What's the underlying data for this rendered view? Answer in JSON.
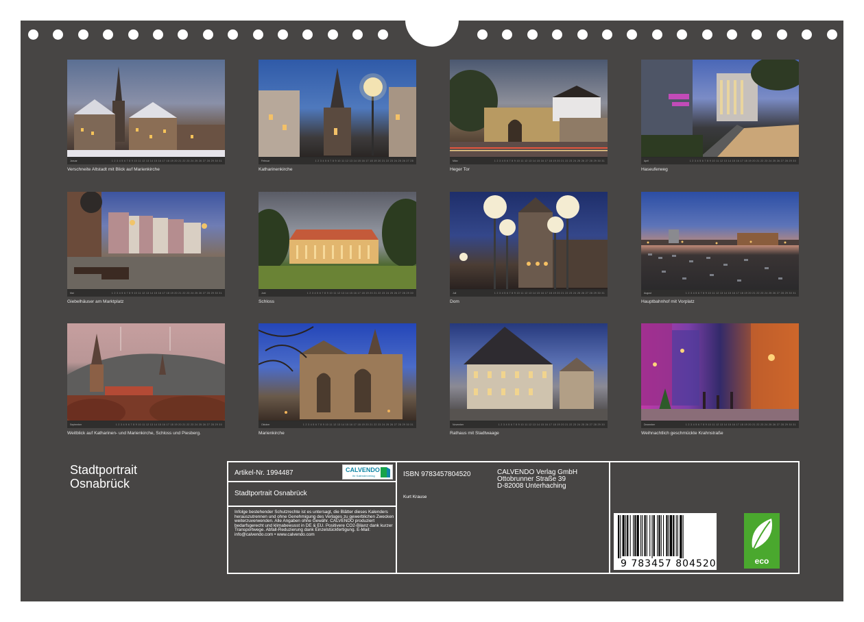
{
  "calendar": {
    "title_line1": "Stadtportrait",
    "title_line2": "Osnabrück"
  },
  "months": [
    {
      "month": "Januar",
      "caption": "Verschneite Altstadt mit Blick auf Marienkirche"
    },
    {
      "month": "Februar",
      "caption": "Katharinenkirche"
    },
    {
      "month": "März",
      "caption": "Heger Tor"
    },
    {
      "month": "April",
      "caption": "Haseuferweg"
    },
    {
      "month": "Mai",
      "caption": "Giebelhäuser am Marktplatz"
    },
    {
      "month": "Juni",
      "caption": "Schloss"
    },
    {
      "month": "Juli",
      "caption": "Dom"
    },
    {
      "month": "August",
      "caption": "Hauptbahnhof mit Vorplatz"
    },
    {
      "month": "September",
      "caption": "Weitblick auf Katharinen- und Marienkirche, Schloss und Piesberg."
    },
    {
      "month": "Oktober",
      "caption": "Marienkirche"
    },
    {
      "month": "November",
      "caption": "Rathaus mit Stadtwaage"
    },
    {
      "month": "Dezember",
      "caption": "Weihnachtlich geschmückte Krahnstraße"
    }
  ],
  "info": {
    "artikel": "Artikel-Nr. 1994487",
    "product_title": "Stadtportrait Osnabrück",
    "legal_text": "Infolge bestehender Schutzrechte ist es untersagt, die Blätter dieses Kalenders herauszutrennen und ohne Genehmigung des Verlages zu gewerblichen Zwecken weiterzuverwenden. Alle Angaben ohne Gewähr. CALVENDO produziert bedarfsgerecht und klimabewusst in DE & EU. Positivere CO2-Bilanz dank kurzer Transportwege. Abfall-Reduzierung dank Einzelstückfertigung. E-Mail: info@calvendo.com • www.calvendo.com",
    "isbn": "ISBN 9783457804520",
    "author": "Kurt Krause",
    "publisher_name": "CALVENDO Verlag GmbH",
    "publisher_street": "Ottobrunner Straße 39",
    "publisher_city": "D-82008 Unterhaching",
    "logo_name": "CALVENDO",
    "logo_sub": "Ihr Kalenderverlag",
    "barcode_digits": "9 783457 804520",
    "eco_label": "eco"
  }
}
